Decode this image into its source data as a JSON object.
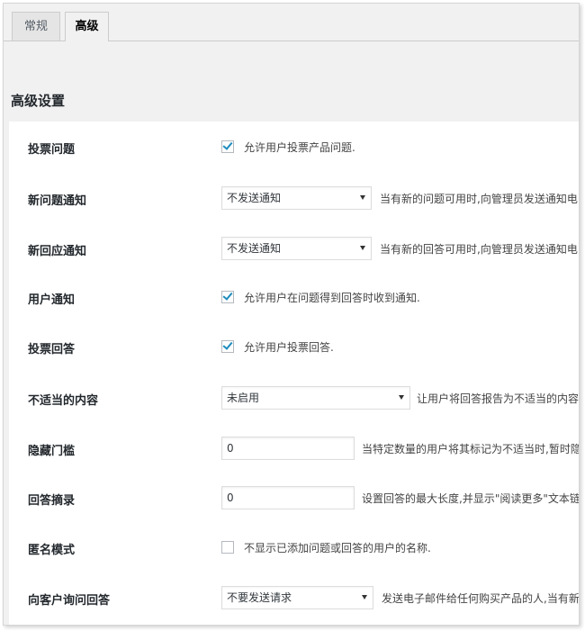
{
  "tabs": [
    {
      "label": "常规"
    },
    {
      "label": "高级"
    }
  ],
  "section_title": "高级设置",
  "settings": {
    "vote_questions": {
      "label": "投票问题",
      "checked": true,
      "text": "允许用户投票产品问题."
    },
    "new_question_notify": {
      "label": "新问题通知",
      "selected": "不发送通知",
      "desc": "当有新的问题可用时,向管理员发送通知电"
    },
    "new_answer_notify": {
      "label": "新回应通知",
      "selected": "不发送通知",
      "desc": "当有新的回答可用时,向管理员发送通知电"
    },
    "user_notify": {
      "label": "用户通知",
      "checked": true,
      "text": "允许用户在问题得到回答时收到通知."
    },
    "vote_answers": {
      "label": "投票回答",
      "checked": true,
      "text": "允许用户投票回答."
    },
    "inappropriate": {
      "label": "不适当的内容",
      "selected": "未启用",
      "desc": "让用户将回答报告为不适当的内容"
    },
    "hide_threshold": {
      "label": "隐藏门槛",
      "value": "0",
      "desc": "当特定数量的用户将其标记为不适当时,暂时隐"
    },
    "answer_excerpt": {
      "label": "回答摘录",
      "value": "0",
      "desc": "设置回答的最大长度,并显示\"阅读更多\"文本链"
    },
    "anonymous_mode": {
      "label": "匿名模式",
      "checked": false,
      "text": "不显示已添加问题或回答的用户的名称."
    },
    "ask_customers": {
      "label": "向客户询问回答",
      "selected": "不要发送请求",
      "desc": "发送电子邮件给任何购买产品的人,当有新"
    }
  },
  "colors": {
    "accent": "#1e8cbe",
    "panel_bg": "#f1f1f1"
  }
}
